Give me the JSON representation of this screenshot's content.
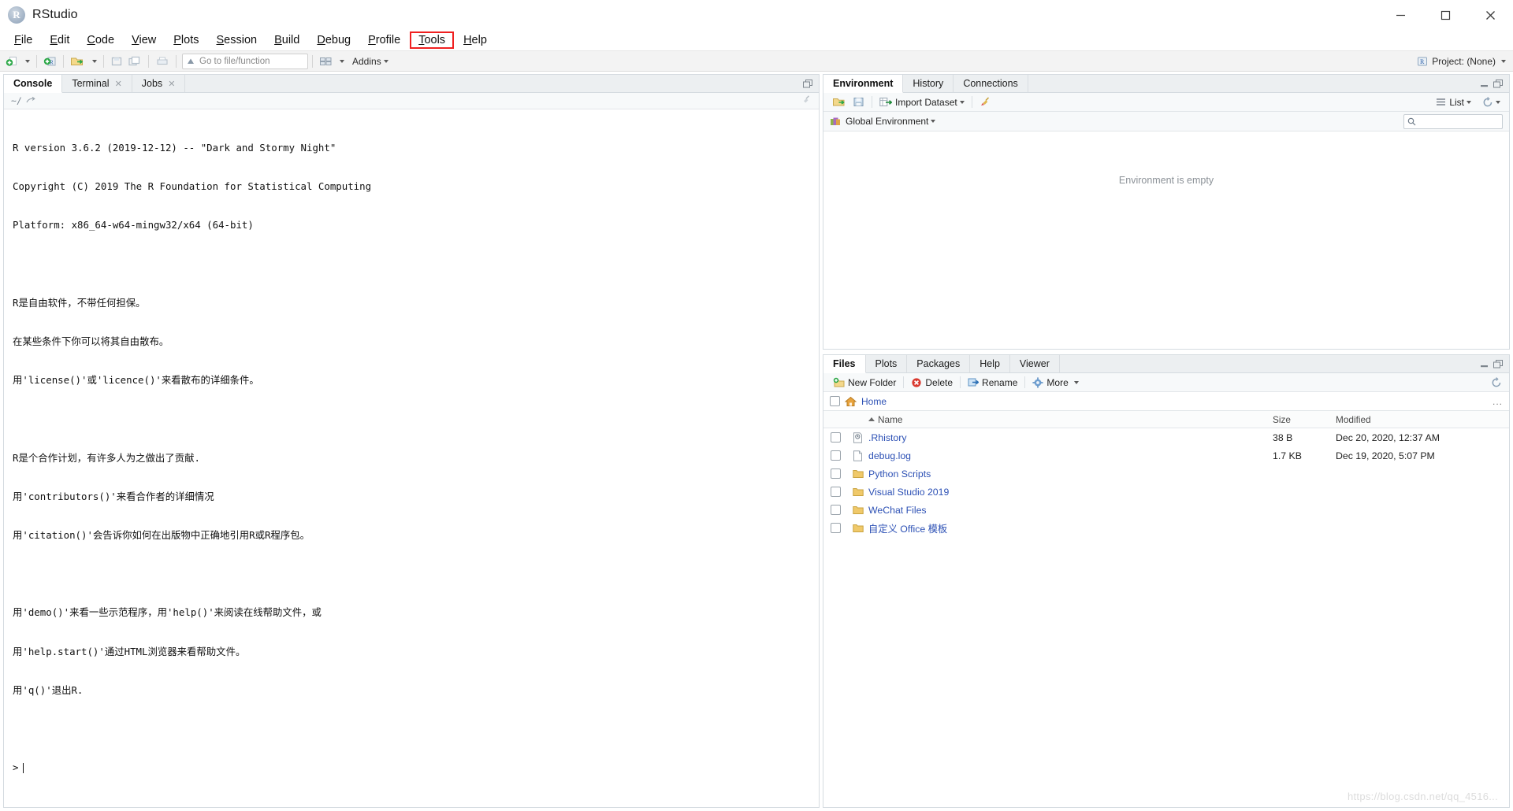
{
  "window": {
    "title": "RStudio",
    "icon": "r-logo-icon",
    "controls": {
      "minimize": "minimize-icon",
      "maximize": "maximize-icon",
      "close": "close-icon"
    }
  },
  "menubar": {
    "items": [
      {
        "label": "File",
        "accel": "F",
        "highlighted": false
      },
      {
        "label": "Edit",
        "accel": "E",
        "highlighted": false
      },
      {
        "label": "Code",
        "accel": "C",
        "highlighted": false
      },
      {
        "label": "View",
        "accel": "V",
        "highlighted": false
      },
      {
        "label": "Plots",
        "accel": "P",
        "highlighted": false
      },
      {
        "label": "Session",
        "accel": "S",
        "highlighted": false
      },
      {
        "label": "Build",
        "accel": "B",
        "highlighted": false
      },
      {
        "label": "Debug",
        "accel": "D",
        "highlighted": false
      },
      {
        "label": "Profile",
        "accel": "P",
        "highlighted": false
      },
      {
        "label": "Tools",
        "accel": "T",
        "highlighted": true
      },
      {
        "label": "Help",
        "accel": "H",
        "highlighted": false
      }
    ],
    "highlight_color": "#f02020"
  },
  "toolbar": {
    "goto_placeholder": "Go to file/function",
    "addins_label": "Addins",
    "project_label": "Project: (None)"
  },
  "console_panel": {
    "tabs": [
      {
        "label": "Console",
        "active": true,
        "closable": false
      },
      {
        "label": "Terminal",
        "active": false,
        "closable": true
      },
      {
        "label": "Jobs",
        "active": false,
        "closable": true
      }
    ],
    "path": "~/",
    "lines": [
      {
        "text": "R version 3.6.2 (2019-12-12) -- \"Dark and Stormy Night\""
      },
      {
        "text": "Copyright (C) 2019 The R Foundation for Statistical Computing"
      },
      {
        "text": "Platform: x86_64-w64-mingw32/x64 (64-bit)"
      },
      {
        "text": ""
      },
      {
        "text": "R是自由软件，不带任何担保。"
      },
      {
        "text": "在某些条件下你可以将其自由散布。"
      },
      {
        "text": "用'license()'或'licence()'来看散布的详细条件。"
      },
      {
        "text": ""
      },
      {
        "text": "R是个合作计划，有许多人为之做出了贡献."
      },
      {
        "text": "用'contributors()'来看合作者的详细情况"
      },
      {
        "text": "用'citation()'会告诉你如何在出版物中正确地引用R或R程序包。"
      },
      {
        "text": ""
      },
      {
        "text": "用'demo()'来看一些示范程序，用'help()'来阅读在线帮助文件，或"
      },
      {
        "text": "用'help.start()'通过HTML浏览器来看帮助文件。"
      },
      {
        "text": "用'q()'退出R."
      },
      {
        "text": ""
      }
    ],
    "prompt": ">"
  },
  "environment_panel": {
    "tabs": [
      {
        "label": "Environment",
        "active": true
      },
      {
        "label": "History",
        "active": false
      },
      {
        "label": "Connections",
        "active": false
      }
    ],
    "toolbar": {
      "open_icon": "open-folder-icon",
      "save_icon": "save-icon",
      "import_label": "Import Dataset",
      "broom_icon": "broom-icon",
      "view_mode": "List",
      "refresh_icon": "refresh-icon"
    },
    "scope": "Global Environment",
    "search_value": "",
    "empty_message": "Environment is empty"
  },
  "files_panel": {
    "tabs": [
      {
        "label": "Files",
        "active": true
      },
      {
        "label": "Plots",
        "active": false
      },
      {
        "label": "Packages",
        "active": false
      },
      {
        "label": "Help",
        "active": false
      },
      {
        "label": "Viewer",
        "active": false
      }
    ],
    "toolbar": {
      "new_folder": "New Folder",
      "delete": "Delete",
      "rename": "Rename",
      "more": "More",
      "refresh_icon": "refresh-icon"
    },
    "breadcrumb": "Home",
    "overflow": "...",
    "columns": {
      "name": "Name",
      "size": "Size",
      "modified": "Modified"
    },
    "sort_column": "Name",
    "sort_direction": "asc",
    "rows": [
      {
        "name": ".Rhistory",
        "type": "history",
        "size": "38 B",
        "modified": "Dec 20, 2020, 12:37 AM"
      },
      {
        "name": "debug.log",
        "type": "file",
        "size": "1.7 KB",
        "modified": "Dec 19, 2020, 5:07 PM"
      },
      {
        "name": "Python Scripts",
        "type": "folder",
        "size": "",
        "modified": ""
      },
      {
        "name": "Visual Studio 2019",
        "type": "folder",
        "size": "",
        "modified": ""
      },
      {
        "name": "WeChat Files",
        "type": "folder",
        "size": "",
        "modified": ""
      },
      {
        "name": "自定义 Office 模板",
        "type": "folder",
        "size": "",
        "modified": ""
      }
    ]
  },
  "watermark": "https://blog.csdn.net/qq_4516..."
}
